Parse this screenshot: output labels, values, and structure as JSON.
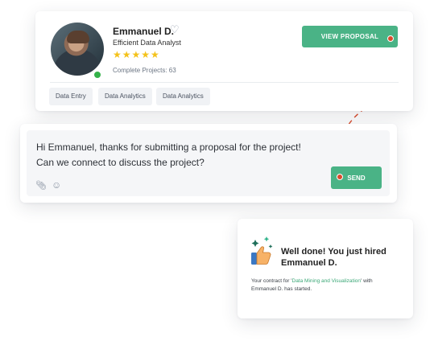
{
  "profile": {
    "name": "Emmanuel D.",
    "role": "Efficient Data Analyst",
    "rating_stars": 5,
    "stars": "★★★★★",
    "projects_label": "Complete Projects: 63",
    "online": true,
    "view_proposal_label": "VIEW PROPOSAL",
    "tags": [
      "Data Entry",
      "Data Analytics",
      "Data Analytics"
    ]
  },
  "message": {
    "lines": [
      "Hi Emmanuel, thanks for submitting a proposal for the project!",
      "Can we connect to discuss the project?"
    ],
    "send_label": "SEND"
  },
  "success": {
    "title_line1": "Well done! You just hired",
    "title_line2": "Emmanuel D.",
    "contract_prefix": "Your contract for '",
    "contract_project": "Data Mining and Visualization",
    "contract_suffix": "' with",
    "contract_line2": "Emmanuel D. has started."
  },
  "icons": {
    "heart": "heart-icon",
    "attach": "paperclip-icon",
    "emoji": "smiley-icon",
    "success": "thumbs-up-sparkles-icon"
  },
  "colors": {
    "accent_green": "#4ab386",
    "star_yellow": "#f4c21a",
    "connector_red": "#d94a2b",
    "online_green": "#35b24a"
  }
}
